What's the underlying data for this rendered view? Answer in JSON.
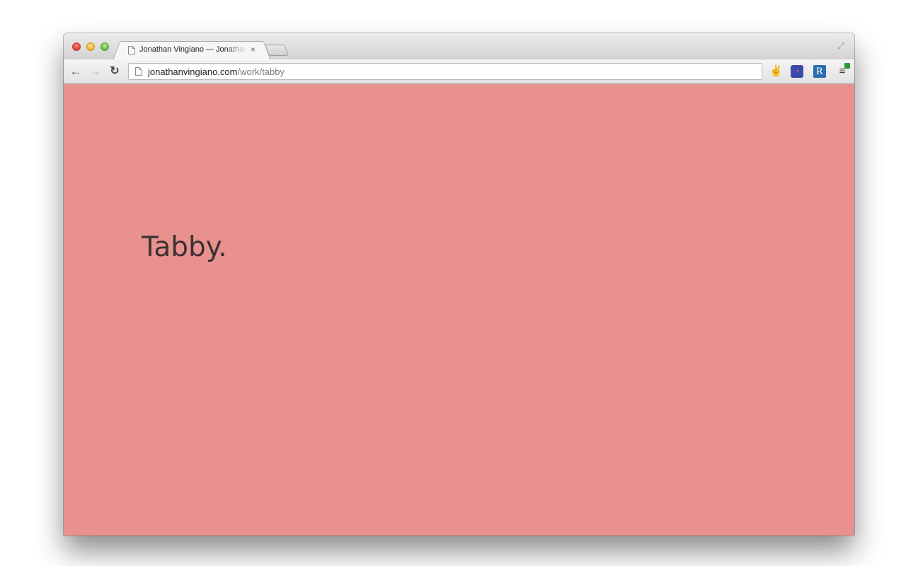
{
  "browser": {
    "tab": {
      "title": "Jonathan Vingiano — Jonathan Vingiano",
      "close_glyph": "×"
    },
    "nav": {
      "back_glyph": "←",
      "forward_glyph": "→",
      "reload_glyph": "↻"
    },
    "address": {
      "host": "jonathanvingiano.com",
      "path": "/work/tabby"
    },
    "extensions": [
      {
        "name": "peace-hand-icon",
        "glyph": "✌"
      },
      {
        "name": "speed-dial-icon",
        "glyph": "◔"
      },
      {
        "name": "r-extension-icon",
        "glyph": "R"
      },
      {
        "name": "menu-icon",
        "glyph": "≡"
      }
    ],
    "fullscreen_glyph": "⤢"
  },
  "page": {
    "headline": "Tabby.",
    "background_color": "#e8918e",
    "text_color": "#3b3233"
  }
}
